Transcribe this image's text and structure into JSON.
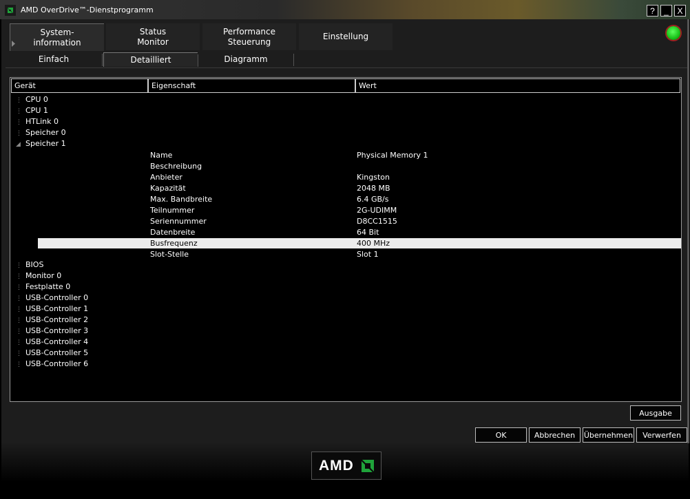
{
  "window": {
    "title": "AMD OverDrive™-Dienstprogramm",
    "help": "?",
    "minimize": "_",
    "close": "X"
  },
  "main_tabs": [
    {
      "line1": "System-",
      "line2": "information"
    },
    {
      "line1": "Status",
      "line2": "Monitor"
    },
    {
      "line1": "Performance",
      "line2": "Steuerung"
    },
    {
      "line1": "Einstellung",
      "line2": ""
    }
  ],
  "sub_tabs": [
    "Einfach",
    "Detailliert",
    "Diagramm"
  ],
  "columns": {
    "device": "Gerät",
    "property": "Eigenschaft",
    "value": "Wert"
  },
  "tree_before": [
    "CPU 0",
    "CPU 1",
    "HTLink 0",
    "Speicher 0"
  ],
  "expanded_node": "Speicher 1",
  "properties": [
    {
      "k": "Name",
      "v": "Physical Memory 1"
    },
    {
      "k": "Beschreibung",
      "v": ""
    },
    {
      "k": "Anbieter",
      "v": "Kingston"
    },
    {
      "k": "Kapazität",
      "v": "2048 MB"
    },
    {
      "k": "Max. Bandbreite",
      "v": "6.4 GB/s"
    },
    {
      "k": "Teilnummer",
      "v": "2G-UDIMM"
    },
    {
      "k": "Seriennummer",
      "v": "D8CC1515"
    },
    {
      "k": "Datenbreite",
      "v": "64 Bit"
    },
    {
      "k": "Busfrequenz",
      "v": "400 MHz"
    },
    {
      "k": "Slot-Stelle",
      "v": "Slot 1"
    }
  ],
  "selected_property": "Busfrequenz",
  "tree_after": [
    "BIOS",
    "Monitor 0",
    "Festplatte 0",
    "USB-Controller 0",
    "USB-Controller 1",
    "USB-Controller 2",
    "USB-Controller 3",
    "USB-Controller 4",
    "USB-Controller 5",
    "USB-Controller 6"
  ],
  "buttons": {
    "ausgabe": "Ausgabe",
    "ok": "OK",
    "abbrechen": "Abbrechen",
    "uebernehmen": "Übernehmen",
    "verwerfen": "Verwerfen"
  },
  "logo": "AMD",
  "colors": {
    "status_led": "#18c018",
    "selection": "#ececec",
    "background": "#000000"
  }
}
